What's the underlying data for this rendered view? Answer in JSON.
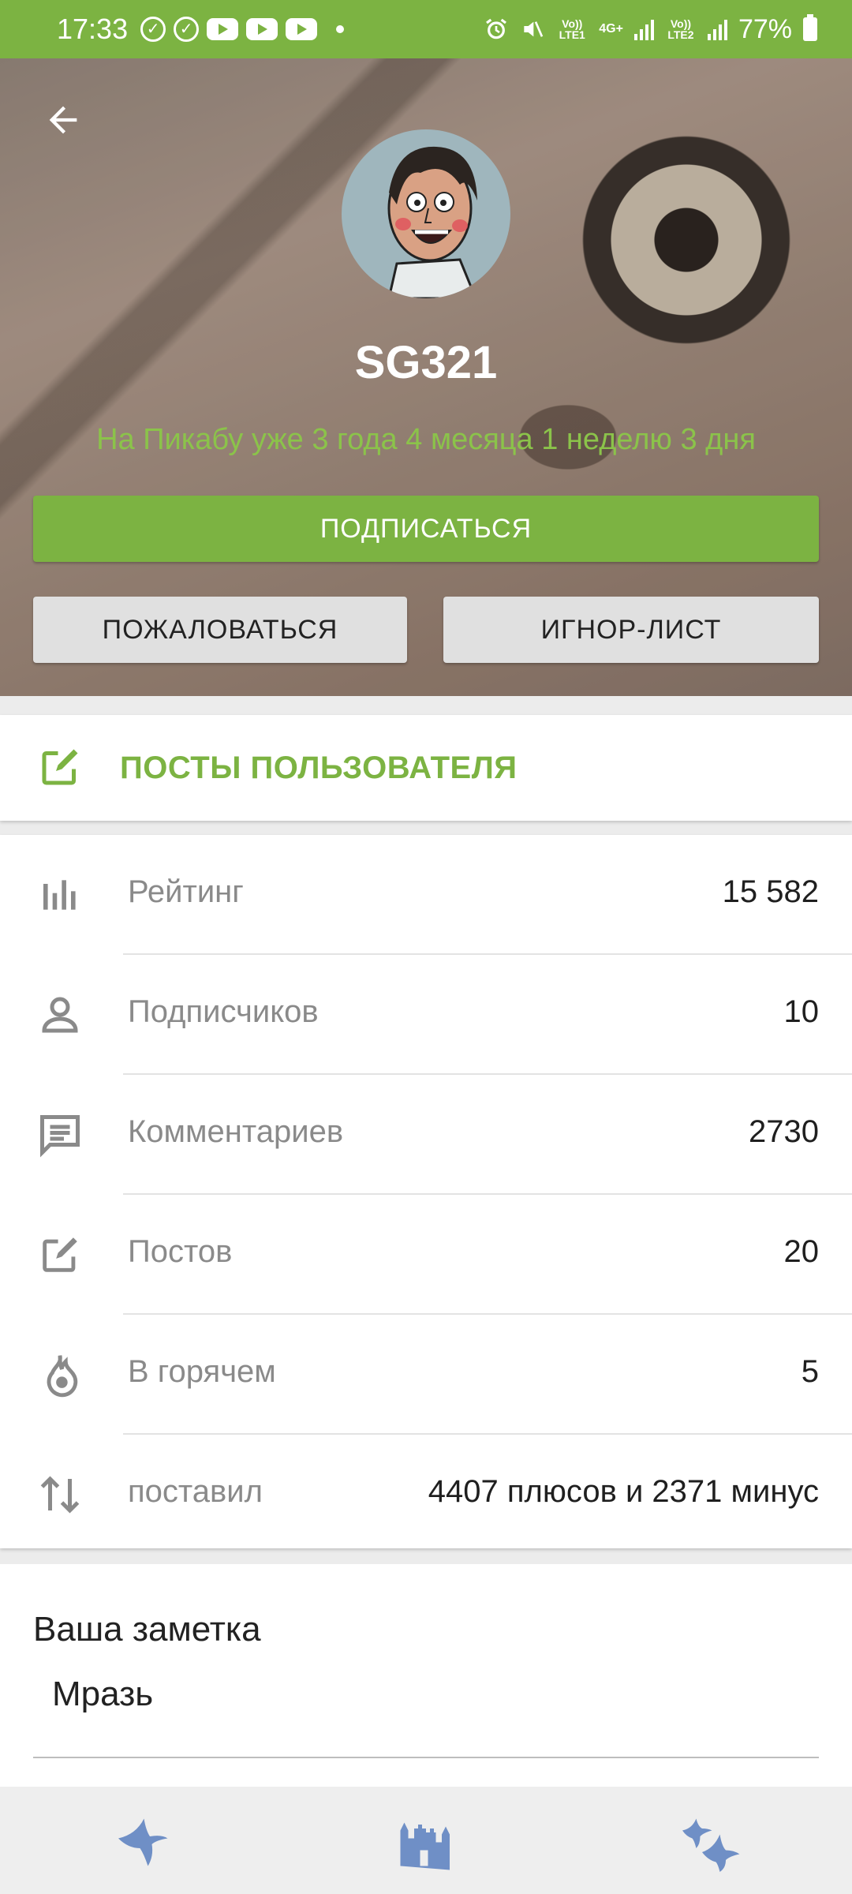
{
  "status_bar": {
    "time": "17:33",
    "network1": "Vo)) LTE1",
    "network2": "Vo)) LTE2",
    "data_type": "4G+",
    "battery": "77%"
  },
  "profile": {
    "username": "SG321",
    "tenure": "На Пикабу уже 3 года 4 месяца 1 неделю 3 дня",
    "subscribe_label": "ПОДПИСАТЬСЯ",
    "report_label": "ПОЖАЛОВАТЬСЯ",
    "ignore_label": "ИГНОР-ЛИСТ"
  },
  "posts": {
    "label": "ПОСТЫ ПОЛЬЗОВАТЕЛЯ"
  },
  "stats": [
    {
      "icon": "rating-icon",
      "label": "Рейтинг",
      "value": "15 582"
    },
    {
      "icon": "person-icon",
      "label": "Подписчиков",
      "value": "10"
    },
    {
      "icon": "comment-icon",
      "label": "Комментариев",
      "value": "2730"
    },
    {
      "icon": "edit-icon",
      "label": "Постов",
      "value": "20"
    },
    {
      "icon": "flame-icon",
      "label": "В горячем",
      "value": "5"
    },
    {
      "icon": "sort-arrows-icon",
      "label": "поставил",
      "value": "4407 плюсов и 2371 минус"
    }
  ],
  "note": {
    "title": "Ваша заметка",
    "text": "Мразь"
  },
  "colors": {
    "accent": "#7cb342",
    "tenure_text": "#8bc34a",
    "nav_icon": "#6f8fc6"
  }
}
